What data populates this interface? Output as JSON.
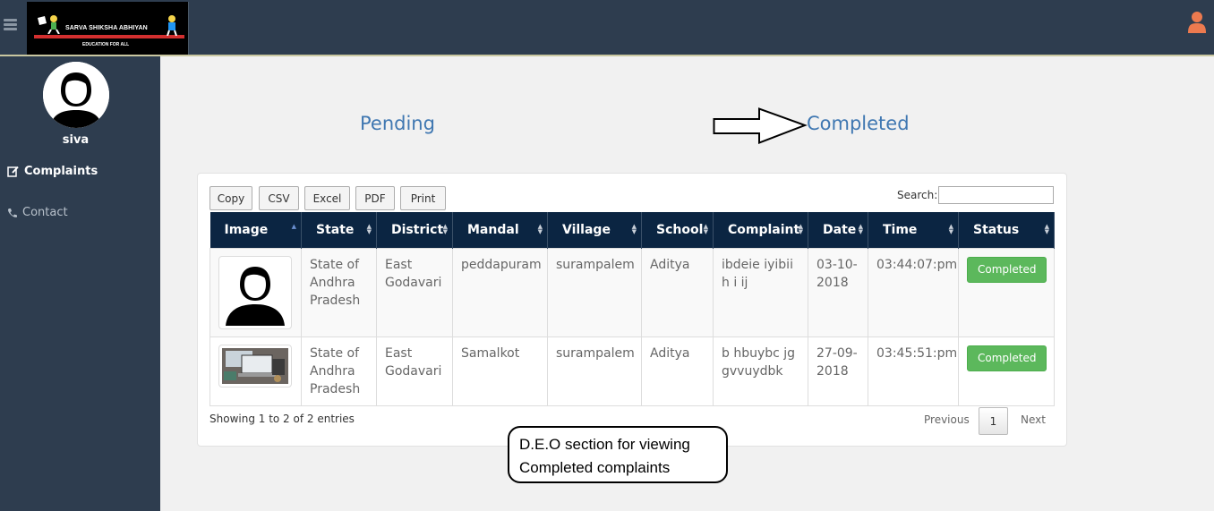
{
  "header": {
    "logo_title": "SARVA SHIKSHA ABHIYAN",
    "logo_tagline": "EDUCATION FOR ALL",
    "menu_icon": "hamburger-icon",
    "user_icon": "user-icon",
    "user_icon_color": "#ec7a4f"
  },
  "sidebar": {
    "username": "siva",
    "items": [
      {
        "label": "Complaints",
        "icon": "edit-icon",
        "active": true
      },
      {
        "label": "Contact",
        "icon": "phone-icon",
        "active": false
      }
    ]
  },
  "tabs": {
    "pending": "Pending",
    "completed": "Completed"
  },
  "toolbar": {
    "buttons": [
      "Copy",
      "CSV",
      "Excel",
      "PDF",
      "Print"
    ],
    "search_label": "Search:",
    "search_value": ""
  },
  "table": {
    "columns": [
      "Image",
      "State",
      "District",
      "Mandal",
      "Village",
      "School",
      "Complaint",
      "Date",
      "Time",
      "Status"
    ],
    "rows": [
      {
        "image": "avatar-silhouette",
        "state": "State of Andhra Pradesh",
        "district": "East Godavari",
        "mandal": "peddapuram",
        "village": "surampalem",
        "school": "Aditya",
        "complaint": "ibdeie iyibiih i ij",
        "date": "03-10-2018",
        "time": "03:44:07:pm",
        "status": "Completed"
      },
      {
        "image": "laptop-photo",
        "state": "State of Andhra Pradesh",
        "district": "East Godavari",
        "mandal": "Samalkot",
        "village": "surampalem",
        "school": "Aditya",
        "complaint": "b hbuybc jggvvuydbk",
        "date": "27-09-2018",
        "time": "03:45:51:pm",
        "status": "Completed"
      }
    ]
  },
  "footer": {
    "info": "Showing 1 to 2 of 2 entries",
    "previous": "Previous",
    "page": "1",
    "next": "Next"
  },
  "annotation": {
    "line1": "D.E.O section for viewing",
    "line2": "Completed complaints"
  },
  "colors": {
    "topbar": "#2e3d4f",
    "table_header": "#0b2542",
    "link": "#3f77b1",
    "status": "#5cb85c"
  }
}
